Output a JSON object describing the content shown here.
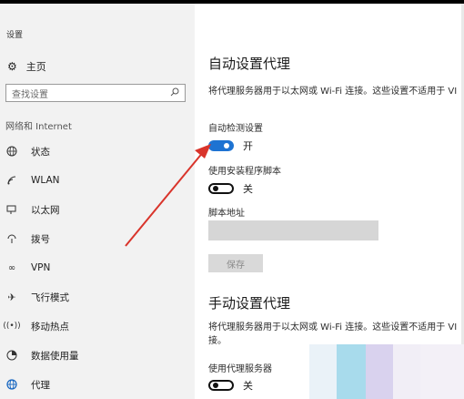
{
  "window": {
    "title": "设置"
  },
  "sidebar": {
    "home_label": "主页",
    "search_placeholder": "查找设置",
    "group_title": "网络和 Internet",
    "items": [
      {
        "label": "状态",
        "icon": "globe-icon"
      },
      {
        "label": "WLAN",
        "icon": "wifi-icon"
      },
      {
        "label": "以太网",
        "icon": "ethernet-icon"
      },
      {
        "label": "拨号",
        "icon": "dialup-icon"
      },
      {
        "label": "VPN",
        "icon": "vpn-icon"
      },
      {
        "label": "飞行模式",
        "icon": "airplane-icon"
      },
      {
        "label": "移动热点",
        "icon": "hotspot-icon"
      },
      {
        "label": "数据使用量",
        "icon": "data-usage-icon"
      },
      {
        "label": "代理",
        "icon": "globe-icon"
      }
    ],
    "active_item": "代理"
  },
  "auto_proxy": {
    "title": "自动设置代理",
    "description": "将代理服务器用于以太网或 Wi-Fi 连接。这些设置不适用于 VI",
    "detect_label": "自动检测设置",
    "detect_state": "开",
    "script_label": "使用安装程序脚本",
    "script_state": "关",
    "address_label": "脚本地址",
    "address_value": "",
    "save_label": "保存"
  },
  "manual_proxy": {
    "title": "手动设置代理",
    "description_line1": "将代理服务器用于以太网或 Wi-Fi 连接。这些设置不适用于 VI",
    "description_line2": "接。",
    "use_proxy_label": "使用代理服务器",
    "use_proxy_state": "关"
  },
  "colors": {
    "accent": "#1e73d2",
    "annotation_arrow": "#d9342b",
    "sidebar_bg": "#f2f2f2"
  }
}
